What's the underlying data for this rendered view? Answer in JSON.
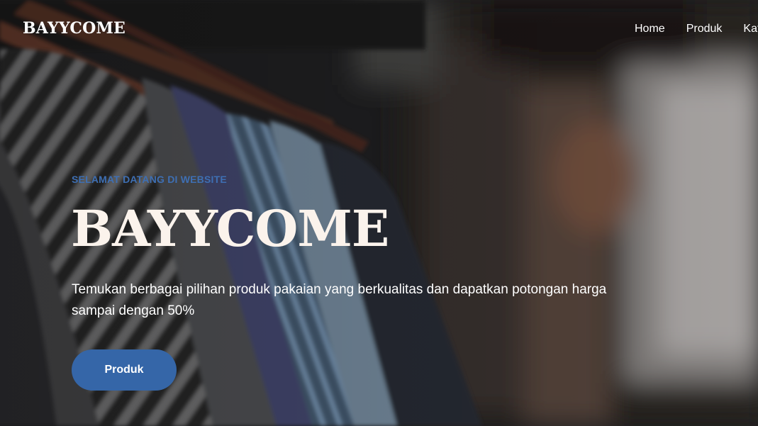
{
  "header": {
    "logo": "BAYYCOME",
    "nav": [
      "Home",
      "Produk",
      "Kat"
    ]
  },
  "hero": {
    "tagline": "SELAMAT DATANG DI WEBSITE",
    "title": "BAYYCOME",
    "description": "Temukan berbagai pilihan produk pakaian yang berkualitas dan dapatkan potongan harga sampai dengan 50%",
    "cta_label": "Produk",
    "cta_color": "#3566a8",
    "tagline_color": "#3e6fb3"
  }
}
